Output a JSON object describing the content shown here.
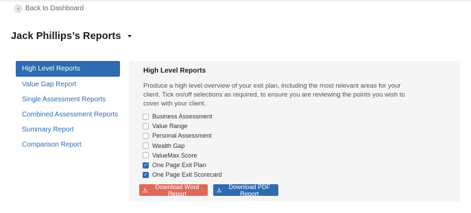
{
  "back": {
    "label": "Back to Dashboard",
    "icon": "chevron-left-icon"
  },
  "page": {
    "title": "Jack Phillips’s Reports",
    "dropdown_icon": "caret-down-icon"
  },
  "sidebar": {
    "items": [
      {
        "label": "High Level Reports",
        "active": true
      },
      {
        "label": "Value Gap Report",
        "active": false
      },
      {
        "label": "Single Assessment Reports",
        "active": false
      },
      {
        "label": "Combined Assessment Reports",
        "active": false
      },
      {
        "label": "Summary Report",
        "active": false
      },
      {
        "label": "Comparison Report",
        "active": false
      }
    ]
  },
  "panel": {
    "title": "High Level Reports",
    "description": "Produce a high level overview of your exit plan, including the most relevant areas for your client. Tick on/off selections as required, to ensure you are reviewing the points you wish to cover with your client.",
    "options": [
      {
        "label": "Business Assessment",
        "checked": false
      },
      {
        "label": "Value Range",
        "checked": false
      },
      {
        "label": "Personal Assessment",
        "checked": false
      },
      {
        "label": "Wealth Gap",
        "checked": false
      },
      {
        "label": "ValueMax Score",
        "checked": false
      },
      {
        "label": "One Page Exit Plan",
        "checked": true
      },
      {
        "label": "One Page Exit Scorecard",
        "checked": true
      }
    ],
    "buttons": {
      "word": "Download Word Report",
      "pdf": "Download PDF Report"
    }
  },
  "colors": {
    "primary": "#2e6bb0",
    "word_button": "#e06a5a",
    "panel_bg": "#f5f5f5"
  }
}
